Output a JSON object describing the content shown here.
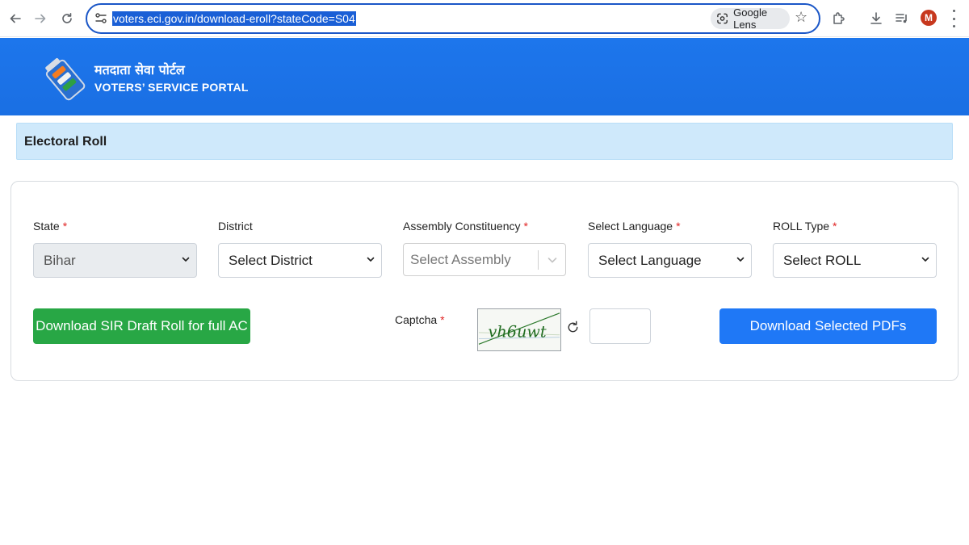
{
  "browser": {
    "url": "voters.eci.gov.in/download-eroll?stateCode=S04",
    "lens_label": "Google Lens",
    "avatar_initial": "M",
    "icons": [
      "back-icon",
      "forward-icon",
      "reload-icon",
      "site-info-icon",
      "google-lens-icon",
      "bookmark-star-icon",
      "extensions-icon",
      "download-icon",
      "media-controls-icon",
      "menu-icon"
    ]
  },
  "header": {
    "brand_hindi": "मतदाता सेवा पोर्टल",
    "brand_english": "VOTERS’ SERVICE PORTAL",
    "accent_color": "#1a73e8"
  },
  "section": {
    "title": "Electoral Roll"
  },
  "form": {
    "required_marker": "*",
    "fields": [
      {
        "label": "State",
        "required": true,
        "value": "Bihar",
        "disabled": true
      },
      {
        "label": "District",
        "required": false,
        "value": "Select District"
      },
      {
        "label": "Assembly Constituency",
        "required": true,
        "placeholder": "Select Assembly"
      },
      {
        "label": "Select Language",
        "required": true,
        "value": "Select Language"
      },
      {
        "label": "ROLL Type",
        "required": true,
        "value": "Select ROLL"
      }
    ],
    "captcha": {
      "label": "Captcha",
      "required": true,
      "image_text": "vh6uwt",
      "input_value": ""
    },
    "buttons": {
      "download_sir": "Download SIR Draft Roll for full AC",
      "download_selected": "Download Selected PDFs"
    },
    "colors": {
      "green_button": "#28a745",
      "blue_button": "#1f78f6",
      "required": "#e02424"
    }
  }
}
